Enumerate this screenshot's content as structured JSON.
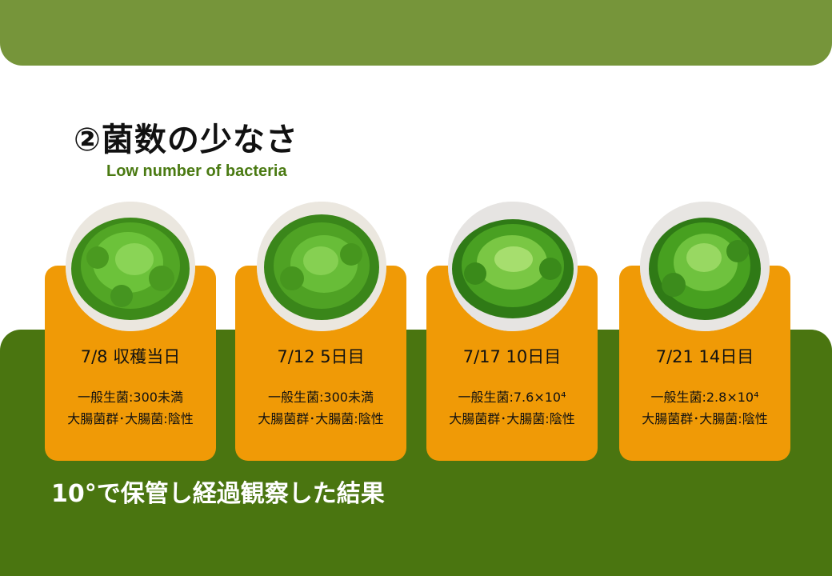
{
  "slide": {
    "title": "②菌数の少なさ",
    "subtitle": "Low number of bacteria",
    "footer": "10°で保管し経過観察した結果",
    "colors": {
      "top_band": "#76953a",
      "bottom_panel": "#4a7510",
      "card": "#f09a06",
      "subtitle": "#4a7a12"
    }
  },
  "cards": [
    {
      "date": "7/8 収穫当日",
      "general_bacteria": "一般生菌:300未満",
      "coliform": "大腸菌群･大腸菌:陰性",
      "photo": "lettuce-photo"
    },
    {
      "date": "7/12 5日目",
      "general_bacteria": "一般生菌:300未満",
      "coliform": "大腸菌群･大腸菌:陰性",
      "photo": "lettuce-photo"
    },
    {
      "date": "7/17 10日目",
      "general_bacteria": "一般生菌:7.6×10⁴",
      "coliform": "大腸菌群･大腸菌:陰性",
      "photo": "lettuce-photo"
    },
    {
      "date": "7/21 14日目",
      "general_bacteria": "一般生菌:2.8×10⁴",
      "coliform": "大腸菌群･大腸菌:陰性",
      "photo": "lettuce-photo"
    }
  ]
}
